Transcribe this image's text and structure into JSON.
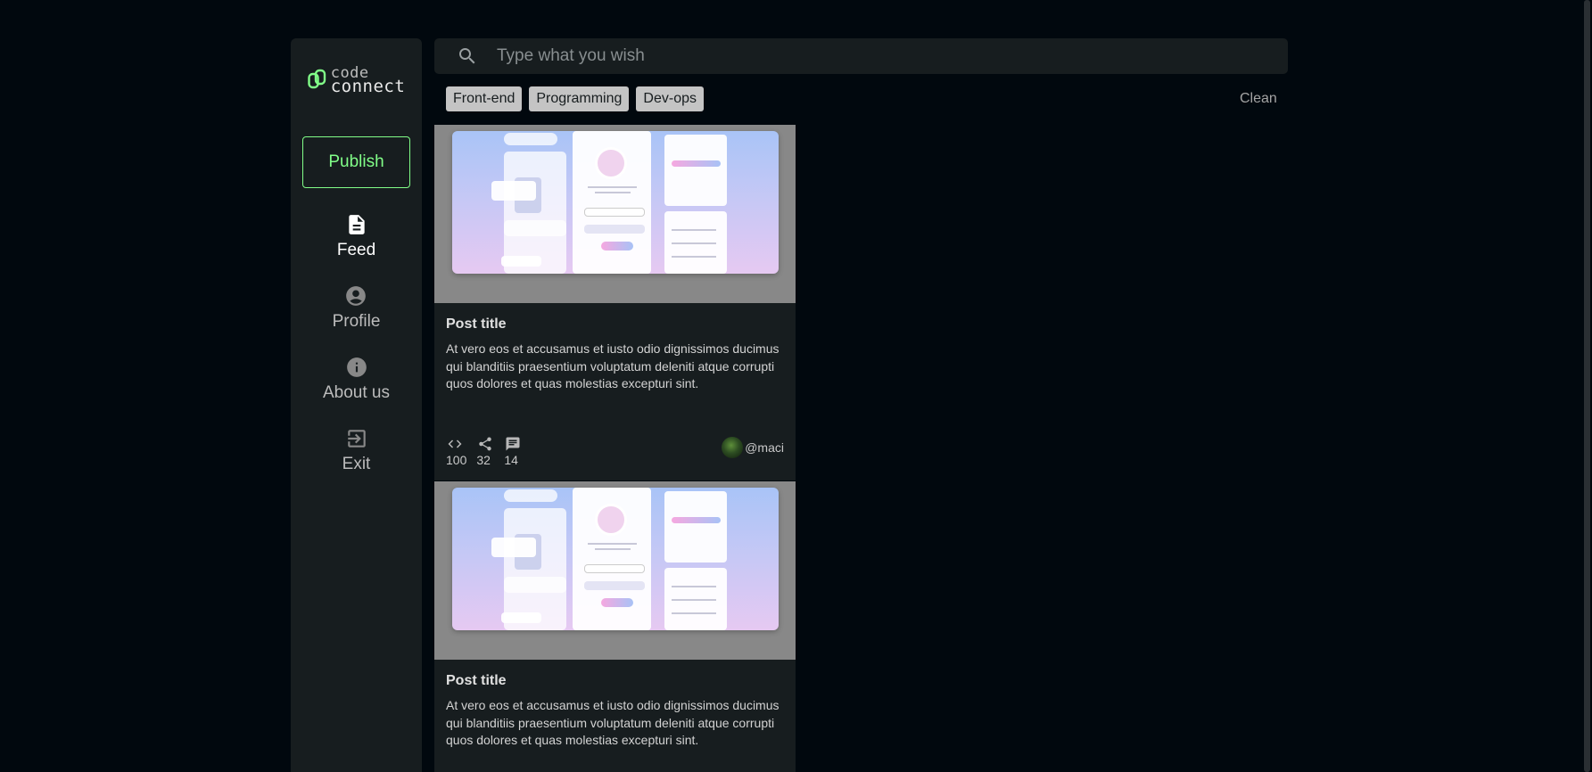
{
  "brand": {
    "line1": "code",
    "line2": "connect"
  },
  "sidebar": {
    "publish_label": "Publish",
    "items": [
      {
        "label": "Feed",
        "icon": "document-icon"
      },
      {
        "label": "Profile",
        "icon": "user-circle-icon"
      },
      {
        "label": "About us",
        "icon": "info-icon"
      },
      {
        "label": "Exit",
        "icon": "logout-icon"
      }
    ]
  },
  "search": {
    "placeholder": "Type what you wish"
  },
  "filters": {
    "tags": [
      "Front-end",
      "Programming",
      "Dev-ops"
    ],
    "clear_label": "Clean"
  },
  "posts": [
    {
      "title": "Post title",
      "body": "At vero eos et accusamus et iusto odio dignissimos ducimus qui blanditiis praesentium voluptatum deleniti atque corrupti quos dolores et quas molestias excepturi sint.",
      "code_count": "100",
      "share_count": "32",
      "comment_count": "14",
      "author": "@maci"
    },
    {
      "title": "Post title",
      "body": "At vero eos et accusamus et iusto odio dignissimos ducimus qui blanditiis praesentium voluptatum deleniti atque corrupti quos dolores et quas molestias excepturi sint."
    }
  ],
  "colors": {
    "accent": "#81fe88",
    "background": "#01080e",
    "panel": "#171d1f"
  }
}
